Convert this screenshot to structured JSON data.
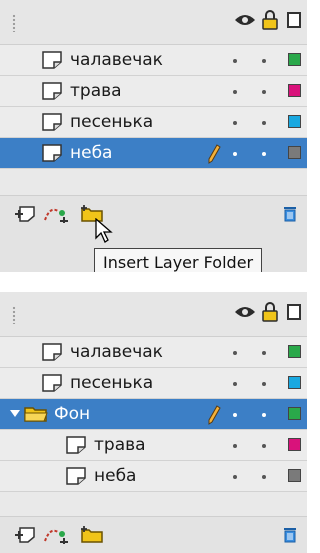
{
  "panel1": {
    "layers": [
      {
        "name": "чалавечак",
        "color": "#2aa84a",
        "selected": false
      },
      {
        "name": "трава",
        "color": "#d9127b",
        "selected": false
      },
      {
        "name": "песенька",
        "color": "#19a8e0",
        "selected": false
      },
      {
        "name": "неба",
        "color": "#7a7a7a",
        "selected": true
      }
    ],
    "tooltip": "Insert Layer Folder"
  },
  "panel2": {
    "layers": [
      {
        "name": "чалавечак",
        "color": "#2aa84a",
        "selected": false
      },
      {
        "name": "песенька",
        "color": "#19a8e0",
        "selected": false
      },
      {
        "name": "Фон",
        "color": "#2aa84a",
        "selected": true,
        "type": "folder"
      },
      {
        "name": "трава",
        "color": "#d9127b",
        "selected": false,
        "nested": true
      },
      {
        "name": "неба",
        "color": "#7a7a7a",
        "selected": false,
        "nested": true
      }
    ]
  },
  "icons": {
    "visibility": "eye-icon",
    "lock": "lock-icon",
    "outline": "outline-icon",
    "new_layer": "new-layer-icon",
    "motion_guide": "motion-guide-icon",
    "new_folder": "new-folder-icon",
    "delete": "trash-icon",
    "edit": "pencil-icon"
  }
}
